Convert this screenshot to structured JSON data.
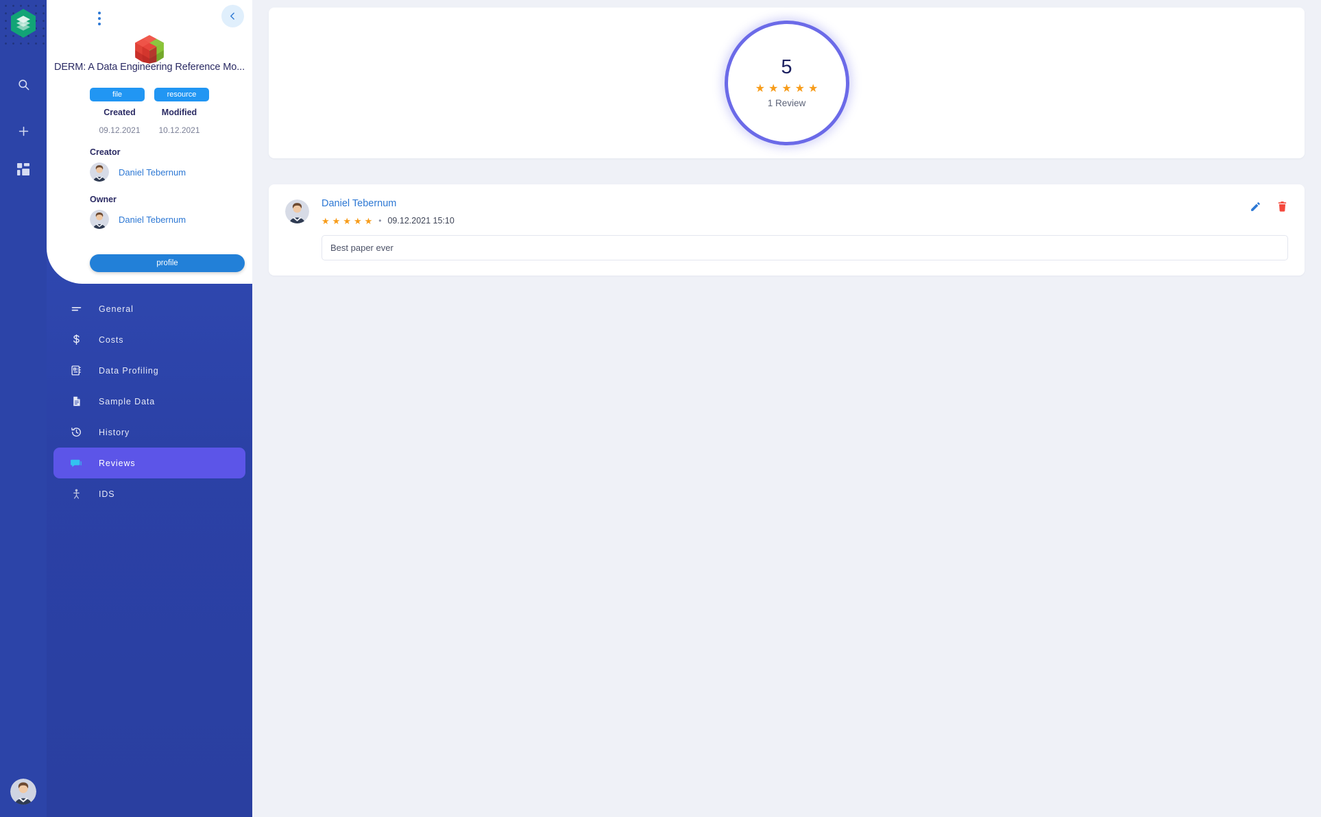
{
  "rail": {
    "logo_name": "layers-hexagon-logo",
    "icons": [
      {
        "name": "search-icon",
        "label": "Search"
      },
      {
        "name": "plus-icon",
        "label": "Add"
      },
      {
        "name": "dashboard-grid-icon",
        "label": "Dashboard"
      }
    ],
    "avatar_alt": "User avatar"
  },
  "detail": {
    "kebab_label": "More options",
    "back_label": "Back",
    "thumbnail_name": "red-green-cube-thumbnail",
    "asset_title": "DERM: A Data Engineering Reference Mo...",
    "tags": [
      {
        "label": "file"
      },
      {
        "label": "resource"
      }
    ],
    "meta": [
      {
        "label": "Created",
        "value": "09.12.2021"
      },
      {
        "label": "Modified",
        "value": "10.12.2021"
      }
    ],
    "creator": {
      "heading": "Creator",
      "name": "Daniel Tebernum"
    },
    "owner": {
      "heading": "Owner",
      "name": "Daniel Tebernum"
    },
    "profile_button": "profile",
    "nav": [
      {
        "label": "General",
        "icon": "list-lines-icon",
        "active": false
      },
      {
        "label": "Costs",
        "icon": "dollar-icon",
        "active": false
      },
      {
        "label": "Data Profiling",
        "icon": "data-profiling-icon",
        "active": false
      },
      {
        "label": "Sample Data",
        "icon": "document-icon",
        "active": false
      },
      {
        "label": "History",
        "icon": "history-clock-icon",
        "active": false
      },
      {
        "label": "Reviews",
        "icon": "speech-bubble-icon",
        "active": true
      },
      {
        "label": "IDS",
        "icon": "ids-person-icon",
        "active": false
      }
    ]
  },
  "summary": {
    "score": "5",
    "stars": 5,
    "count_label": "1 Review",
    "accent_color": "#6b6ae8",
    "star_color": "#f79c1a"
  },
  "reviews": [
    {
      "author": "Daniel Tebernum",
      "stars": 5,
      "separator": "•",
      "date": "09.12.2021 15:10",
      "text": "Best paper ever",
      "edit_label": "Edit review",
      "delete_label": "Delete review"
    }
  ],
  "colors": {
    "page_bg": "#eff1f7",
    "sidebar_blue": "#2c44a8",
    "active_nav": "#5c55e8",
    "link_blue": "#2d78d4",
    "tag_blue": "#2196f3",
    "delete_red": "#f4483c"
  }
}
